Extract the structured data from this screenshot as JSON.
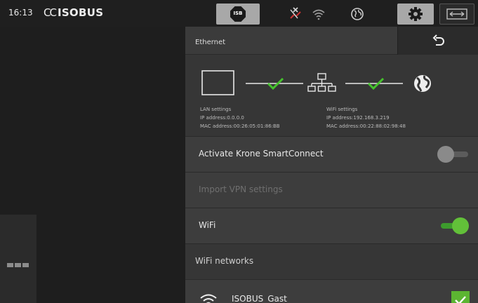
{
  "statusbar": {
    "time": "16:13",
    "brand_prefix": "CC",
    "brand": "ISOBUS",
    "isb_label": "ISB"
  },
  "panel": {
    "title": "Ethernet"
  },
  "connection": {
    "lan": {
      "heading": "LAN settings",
      "ip": "IP address:0.0.0.0",
      "mac": "MAC address:00:26:05:01:86:BB",
      "linked": true
    },
    "wifi": {
      "heading": "WiFi settings",
      "ip": "IP address:192.168.3.219",
      "mac": "MAC address:00:22:88:02:98:48",
      "linked": true
    }
  },
  "rows": {
    "smartconnect": {
      "label": "Activate Krone SmartConnect",
      "toggle_on": false
    },
    "import_vpn": {
      "label": "Import VPN settings",
      "enabled": false
    },
    "wifi": {
      "label": "WiFi",
      "toggle_on": true
    },
    "wifi_networks": {
      "label": "WiFi networks"
    }
  },
  "networks": [
    {
      "ssid": "ISOBUS_Gast",
      "connected": true
    }
  ],
  "colors": {
    "accent_green": "#5cb532",
    "toggle_on": "#62c039",
    "header_button": "#a8a8a8",
    "panel_bg": "#363636"
  },
  "icons": {
    "settings": "gear-icon",
    "back": "return-arrow-icon",
    "globe": "globe-icon",
    "network": "network-tree-icon",
    "wifi": "wifi-icon",
    "no_connection": "disconnected-icon",
    "monitor": "monitor-icon",
    "switch": "swap-screen-icon",
    "menu": "menu-dots-icon"
  }
}
